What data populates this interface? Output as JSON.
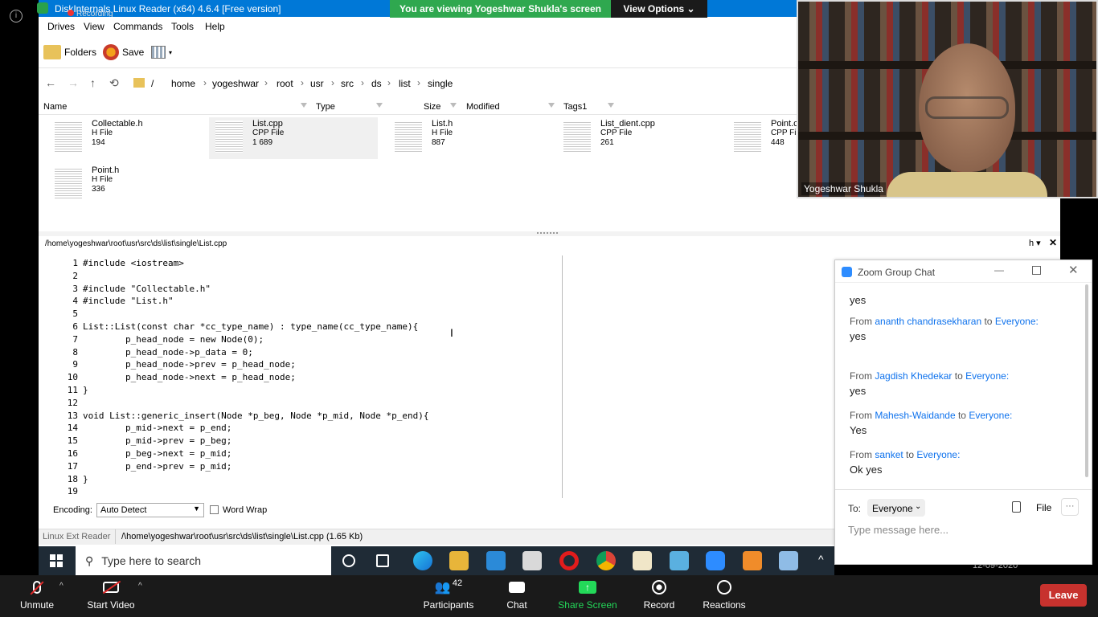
{
  "window": {
    "title": "DiskInternals Linux Reader (x64) 4.6.4 [Free version]",
    "recording": "Recording"
  },
  "menu": [
    "Drives",
    "View",
    "Commands",
    "Tools",
    "Help"
  ],
  "toolbar": {
    "folders": "Folders",
    "save": "Save"
  },
  "breadcrumb": [
    "/",
    "home",
    "yogeshwar",
    "root",
    "usr",
    "src",
    "ds",
    "list",
    "single"
  ],
  "columns": [
    "Name",
    "Type",
    "Size",
    "Modified",
    "Tags1"
  ],
  "files": [
    {
      "name": "Collectable.h",
      "type": "H File",
      "size": "194"
    },
    {
      "name": "List.cpp",
      "type": "CPP File",
      "size": "1 689"
    },
    {
      "name": "List.h",
      "type": "H File",
      "size": "887"
    },
    {
      "name": "List_dient.cpp",
      "type": "CPP File",
      "size": "261"
    },
    {
      "name": "Point.c",
      "type": "CPP Fi",
      "size": "448"
    },
    {
      "name": "Point.h",
      "type": "H File",
      "size": "336"
    }
  ],
  "editor": {
    "path": "/home\\yogeshwar\\root\\usr\\src\\ds\\list\\single\\List.cpp",
    "lines": [
      {
        "n": "1",
        "code": "#include <iostream>"
      },
      {
        "n": "2",
        "code": ""
      },
      {
        "n": "3",
        "code": "#include \"Collectable.h\""
      },
      {
        "n": "4",
        "code": "#include \"List.h\""
      },
      {
        "n": "5",
        "code": ""
      },
      {
        "n": "6",
        "code": "List::List(const char *cc_type_name) : type_name(cc_type_name){"
      },
      {
        "n": "7",
        "code": "        p_head_node = new Node(0);"
      },
      {
        "n": "8",
        "code": "        p_head_node->p_data = 0;"
      },
      {
        "n": "9",
        "code": "        p_head_node->prev = p_head_node;"
      },
      {
        "n": "10",
        "code": "        p_head_node->next = p_head_node;"
      },
      {
        "n": "11",
        "code": "}"
      },
      {
        "n": "12",
        "code": ""
      },
      {
        "n": "13",
        "code": "void List::generic_insert(Node *p_beg, Node *p_mid, Node *p_end){"
      },
      {
        "n": "14",
        "code": "        p_mid->next = p_end;"
      },
      {
        "n": "15",
        "code": "        p_mid->prev = p_beg;"
      },
      {
        "n": "16",
        "code": "        p_beg->next = p_mid;"
      },
      {
        "n": "17",
        "code": "        p_end->prev = p_mid;"
      },
      {
        "n": "18",
        "code": "}"
      },
      {
        "n": "19",
        "code": ""
      }
    ],
    "encoding_label": "Encoding:",
    "encoding_value": "Auto Detect",
    "word_wrap": "Word Wrap",
    "h_label": "h"
  },
  "status": {
    "left": "Linux Ext Reader",
    "path": "/\\home\\yogeshwar\\root\\usr\\src\\ds\\list\\single\\List.cpp (1.65 Kb)"
  },
  "taskbar": {
    "search_placeholder": "Type here to search",
    "date": "12-09-2020"
  },
  "banner": {
    "text": "You are viewing Yogeshwar Shukla's screen",
    "view_options": "View Options"
  },
  "video": {
    "name": "Yogeshwar Shukla"
  },
  "chat": {
    "title": "Zoom Group Chat",
    "messages": [
      {
        "body": "yes"
      },
      {
        "from": "From",
        "name": "ananth chandrasekharan",
        "to": "to",
        "target": "Everyone:",
        "body": "yes"
      },
      {
        "from": "From",
        "name": "Jagdish Khedekar",
        "to": "to",
        "target": "Everyone:",
        "body": "yes"
      },
      {
        "from": "From",
        "name": "Mahesh-Waidande",
        "to": "to",
        "target": "Everyone:",
        "body": "Yes"
      },
      {
        "from": "From",
        "name": "sanket",
        "to": "to",
        "target": "Everyone:",
        "body": "Ok yes"
      }
    ],
    "to_label": "To:",
    "to_value": "Everyone",
    "file": "File",
    "input_placeholder": "Type message here..."
  },
  "zoom_bar": {
    "unmute": "Unmute",
    "start_video": "Start Video",
    "participants": "Participants",
    "participants_count": "42",
    "chat": "Chat",
    "share": "Share Screen",
    "record": "Record",
    "reactions": "Reactions",
    "leave": "Leave"
  }
}
